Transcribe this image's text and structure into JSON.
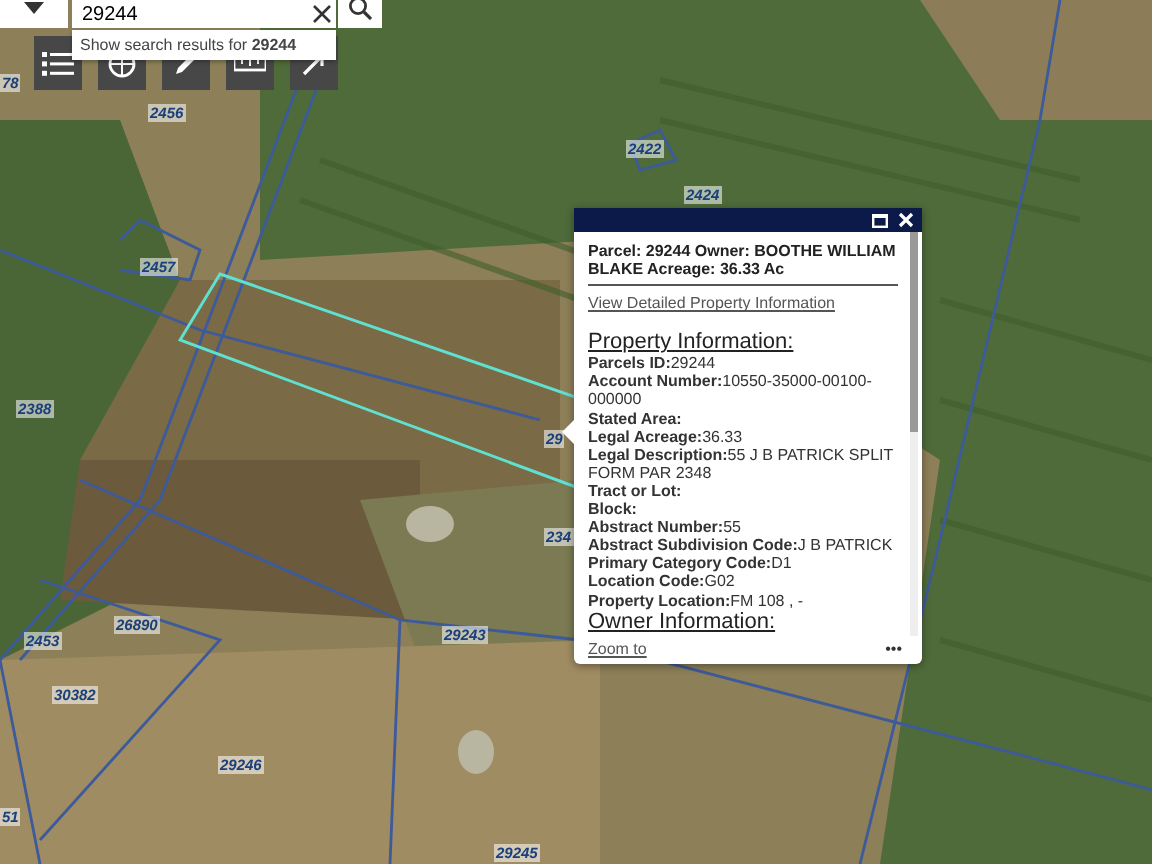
{
  "search": {
    "value": "29244",
    "suggestion": {
      "prefix": "Show search results for ",
      "term": "29244"
    }
  },
  "toolbar": {
    "tools": [
      {
        "kind": "list"
      },
      {
        "kind": "globe"
      },
      {
        "kind": "pencil"
      },
      {
        "kind": "ruler"
      },
      {
        "kind": "share"
      }
    ]
  },
  "map": {
    "parcel_labels": [
      {
        "text": "78"
      },
      {
        "text": "2456"
      },
      {
        "text": "2422"
      },
      {
        "text": "2424"
      },
      {
        "text": "2457"
      },
      {
        "text": "2388"
      },
      {
        "text": "29"
      },
      {
        "text": "234"
      },
      {
        "text": "26890"
      },
      {
        "text": "2453"
      },
      {
        "text": "30382"
      },
      {
        "text": "29243"
      },
      {
        "text": "29246"
      },
      {
        "text": "51"
      },
      {
        "text": "29245"
      }
    ]
  },
  "popup": {
    "title": "Parcel: 29244 Owner: BOOTHE WILLIAM BLAKE Acreage: 36.33 Ac",
    "detail_link": "View Detailed Property Information",
    "section_heading": "Property Information:",
    "fields": [
      {
        "label": "Parcels ID:",
        "value": "29244"
      },
      {
        "label": "Account Number:",
        "value": "10550-35000-00100-000000"
      },
      {
        "label": "Stated Area:"
      },
      {
        "label": "Legal Acreage:",
        "value": "36.33"
      },
      {
        "label": "Legal Description:",
        "value": "55 J B PATRICK SPLIT FORM PAR 2348"
      },
      {
        "label": "Tract or Lot:"
      },
      {
        "label": "Block:"
      },
      {
        "label": "Abstract Number:",
        "value": "55"
      },
      {
        "label": "Abstract Subdivision Code:",
        "value": "J B PATRICK"
      },
      {
        "label": "Primary Category Code:",
        "value": "D1"
      },
      {
        "label": "Location Code:",
        "value": "G02"
      },
      {
        "label": "Property Location:",
        "value": "FM 108 , -"
      }
    ],
    "next_heading": "Owner Information:",
    "zoom_link": "Zoom to",
    "menu": "•••"
  }
}
